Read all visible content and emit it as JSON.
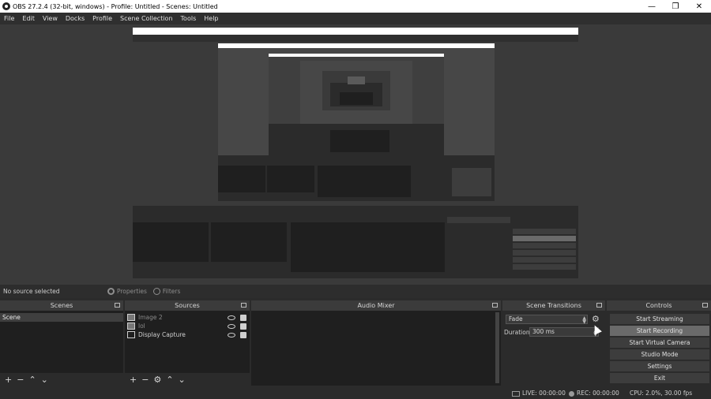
{
  "window": {
    "title": "OBS 27.2.4 (32-bit, windows) - Profile: Untitled - Scenes: Untitled",
    "minimize": "—",
    "maximize": "❐",
    "close": "✕"
  },
  "menu": [
    "File",
    "Edit",
    "View",
    "Docks",
    "Profile",
    "Scene Collection",
    "Tools",
    "Help"
  ],
  "source_bar": {
    "no_source": "No source selected",
    "properties": "Properties",
    "filters": "Filters"
  },
  "scenes": {
    "title": "Scenes",
    "items": [
      "Scene"
    ]
  },
  "sources": {
    "title": "Sources",
    "items": [
      {
        "name": "Image 2",
        "icon": "image-icon"
      },
      {
        "name": "lol",
        "icon": "image-icon"
      },
      {
        "name": "Display Capture",
        "icon": "monitor-icon"
      }
    ]
  },
  "audio_mixer": {
    "title": "Audio Mixer"
  },
  "transitions": {
    "title": "Scene Transitions",
    "selected": "Fade",
    "duration_label": "Duration",
    "duration_value": "300 ms"
  },
  "controls": {
    "title": "Controls",
    "buttons": [
      "Start Streaming",
      "Start Recording",
      "Start Virtual Camera",
      "Studio Mode",
      "Settings",
      "Exit"
    ]
  },
  "status": {
    "live": "LIVE: 00:00:00",
    "rec": "REC: 00:00:00",
    "cpu": "CPU: 2.0%, 30.00 fps"
  },
  "tool_icons": {
    "add": "+",
    "remove": "−",
    "up": "⌃",
    "down": "⌄"
  }
}
